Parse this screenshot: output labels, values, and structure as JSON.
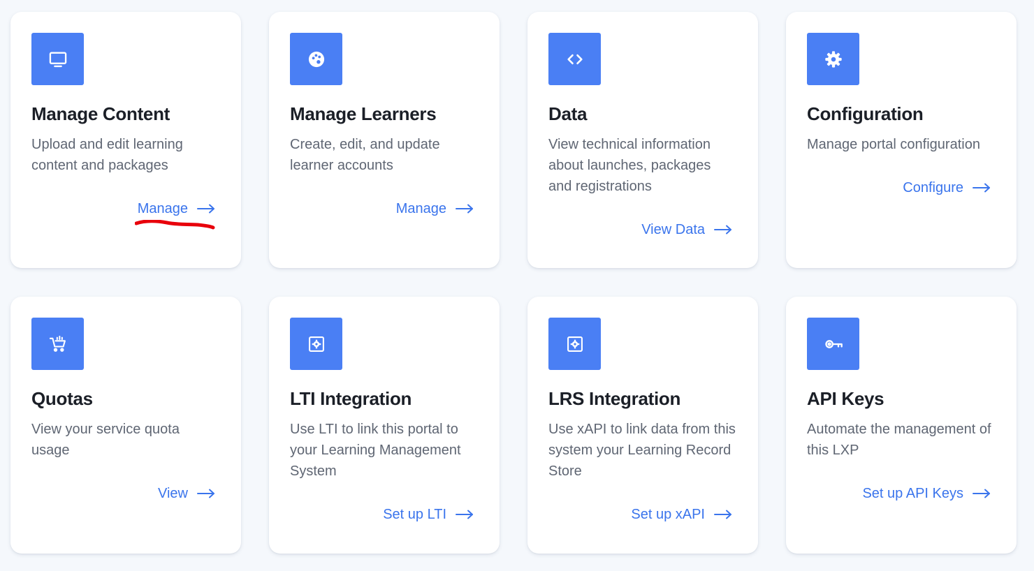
{
  "colors": {
    "icon_background": "#4a7ff4",
    "link": "#3a74ec",
    "title": "#1b1f27",
    "description": "#5f6673",
    "page_background": "#f5f8fc",
    "annotation": "#e8000b"
  },
  "cards": [
    {
      "icon": "monitor-icon",
      "title": "Manage Content",
      "description": "Upload and edit learning content and packages",
      "link": "Manage"
    },
    {
      "icon": "palette-icon",
      "title": "Manage Learners",
      "description": "Create, edit, and update learner accounts",
      "link": "Manage"
    },
    {
      "icon": "code-icon",
      "title": "Data",
      "description": "View technical information about launches, packages and registrations",
      "link": "View Data"
    },
    {
      "icon": "gear-icon",
      "title": "Configuration",
      "description": "Manage portal configuration",
      "link": "Configure"
    },
    {
      "icon": "cart-icon",
      "title": "Quotas",
      "description": "View your service quota usage",
      "link": "View"
    },
    {
      "icon": "gear-square-icon",
      "title": "LTI Integration",
      "description": "Use LTI to link this portal to your Learning Management System",
      "link": "Set up LTI"
    },
    {
      "icon": "gear-square-icon",
      "title": "LRS Integration",
      "description": "Use xAPI to link data from this system your Learning Record Store",
      "link": "Set up xAPI"
    },
    {
      "icon": "key-icon",
      "title": "API Keys",
      "description": "Automate the management of this LXP",
      "link": "Set up API Keys"
    }
  ]
}
